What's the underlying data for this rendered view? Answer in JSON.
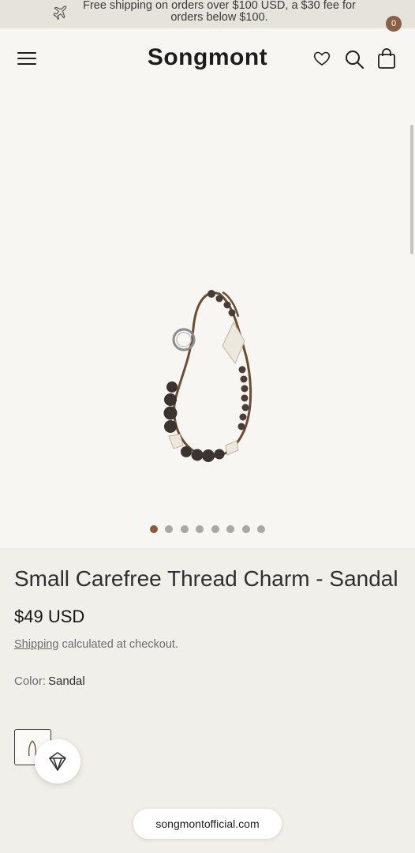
{
  "announcement": {
    "text": "Free shipping on orders over $100 USD, a $30 fee for orders below $100.",
    "icon": "airplane-icon"
  },
  "header": {
    "brand": "Songmont",
    "cart_count": "0",
    "icons": [
      "menu-icon",
      "heart-icon",
      "search-icon",
      "bag-icon"
    ]
  },
  "gallery": {
    "slide_count": 8,
    "active_slide": 1
  },
  "product": {
    "title": "Small Carefree Thread Charm - Sandal",
    "price": "$49 USD",
    "shipping_link": "Shipping",
    "shipping_note": " calculated at checkout.",
    "color_label": "Color:",
    "color_value": "Sandal"
  },
  "browser": {
    "url": "songmontofficial.com"
  },
  "colors": {
    "accent": "#8a6044",
    "active_dot": "#8c5a3a",
    "background": "#f1efea"
  }
}
